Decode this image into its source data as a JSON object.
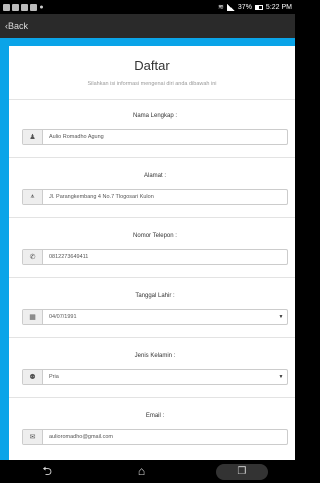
{
  "status_bar": {
    "battery": "37%",
    "time": "5:22 PM"
  },
  "app_bar": {
    "back_label": "‹Back"
  },
  "form": {
    "title": "Daftar",
    "subtitle": "Silahkan isi informasi mengenai diri anda dibawah ini",
    "fields": [
      {
        "label": "Nama Lengkap :",
        "value": "Aulio Romadho Agung",
        "icon": "user-icon"
      },
      {
        "label": "Alamat :",
        "value": "Jl. Parangkembang 4 No.7 Tlogosari Kulon",
        "icon": "road-icon"
      },
      {
        "label": "Nomor Telepon :",
        "value": "0812273649411",
        "icon": "phone-icon"
      },
      {
        "label": "Tanggal Lahir :",
        "value": "04/07/1991",
        "icon": "calendar-icon"
      },
      {
        "label": "Jenis Kelamin :",
        "value": "Pria",
        "icon": "users-icon"
      },
      {
        "label": "Email :",
        "value": "aulioromadho@gmail.com",
        "icon": "envelope-icon"
      }
    ]
  },
  "nav_bar": {
    "back_icon": "back-icon",
    "home_icon": "home-icon",
    "recent_icon": "recent-apps-icon"
  },
  "colors": {
    "accent": "#0aa4e8",
    "app_bar": "#2a2a2a"
  }
}
